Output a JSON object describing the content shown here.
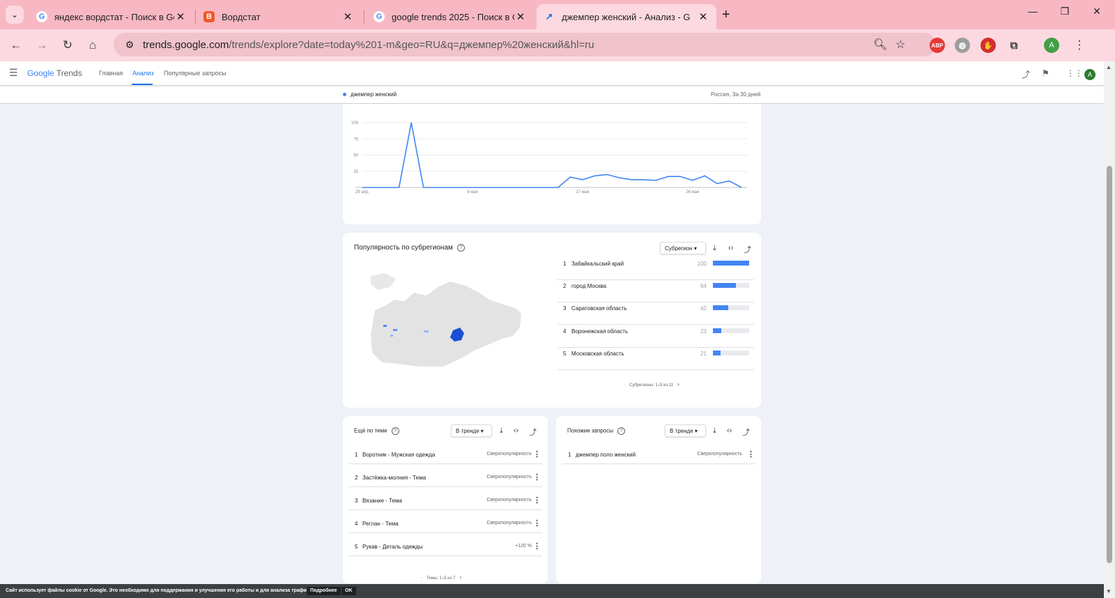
{
  "browser": {
    "tabs": [
      {
        "title": "яндекс вордстат - Поиск в Goo",
        "favicon": "google-icon",
        "active": false
      },
      {
        "title": "Вордстат",
        "favicon": "wordstat-icon",
        "active": false
      },
      {
        "title": "google trends 2025 - Поиск в G",
        "favicon": "google-icon",
        "active": false
      },
      {
        "title": "джемпер женский - Анализ - G",
        "favicon": "trends-icon",
        "active": true
      }
    ],
    "url_domain": "trends.google.com",
    "url_path": "/trends/explore?date=today%201-m&geo=RU&q=джемпер%20женский&hl=ru",
    "extensions": {
      "abp": "ABP"
    },
    "profile_initial": "A"
  },
  "trends_header": {
    "logo_google": "Google",
    "logo_trends": "Trends",
    "nav": [
      "Главная",
      "Анализ",
      "Популярные запросы"
    ],
    "active_nav": "Анализ",
    "avatar_initial": "A"
  },
  "subheader": {
    "term": "джемпер женский",
    "geo_period": "Россия, За 30 дней"
  },
  "chart_data": {
    "type": "line",
    "series": [
      {
        "values": [
          0,
          0,
          0,
          0,
          100,
          0,
          0,
          0,
          0,
          0,
          0,
          0,
          0,
          0,
          0,
          0,
          0,
          16,
          12,
          18,
          20,
          15,
          12,
          12,
          11,
          17,
          17,
          11,
          18,
          6,
          10,
          0
        ]
      }
    ],
    "y_ticks": [
      "100",
      "75",
      "50",
      "25"
    ],
    "x_ticks": [
      "29 апр.",
      "8 мая",
      "17 мая",
      "26 мая"
    ],
    "ylim": [
      0,
      100
    ],
    "color": "#4285f4"
  },
  "subregion_card": {
    "title": "Популярность по субрегионам",
    "select": "Субрегион",
    "rows": [
      {
        "rank": "1",
        "name": "Забайкальский край",
        "value": 100
      },
      {
        "rank": "2",
        "name": "город Москва",
        "value": 64
      },
      {
        "rank": "3",
        "name": "Саратовская область",
        "value": 42
      },
      {
        "rank": "4",
        "name": "Воронежская область",
        "value": 23
      },
      {
        "rank": "5",
        "name": "Московская область",
        "value": 21
      }
    ],
    "pager": "Субрегионы: 1–5 из 11"
  },
  "topics_card": {
    "title": "Ещё по теме",
    "select": "В тренде",
    "rows": [
      {
        "rank": "1",
        "name": "Воротник - Мужская одежда",
        "value": "Сверхпопулярность"
      },
      {
        "rank": "2",
        "name": "Застёжка-молния - Тема",
        "value": "Сверхпопулярность"
      },
      {
        "rank": "3",
        "name": "Вязание - Тема",
        "value": "Сверхпопулярность"
      },
      {
        "rank": "4",
        "name": "Реглан - Тема",
        "value": "Сверхпопулярность"
      },
      {
        "rank": "5",
        "name": "Рукав - Деталь одежды",
        "value": "+120 %"
      }
    ],
    "pager": "Темы: 1–5 из 7"
  },
  "queries_card": {
    "title": "Похожие запросы",
    "select": "В тренде",
    "rows": [
      {
        "rank": "1",
        "name": "джемпер поло женский",
        "value": "Сверхпопулярность"
      }
    ]
  },
  "cookie_bar": {
    "message": "Сайт использует файлы cookie от Google. Это необходимо для поддержания и улучшения его работы и для анализа трафика.",
    "more": "Подробнее",
    "ok": "OK"
  }
}
